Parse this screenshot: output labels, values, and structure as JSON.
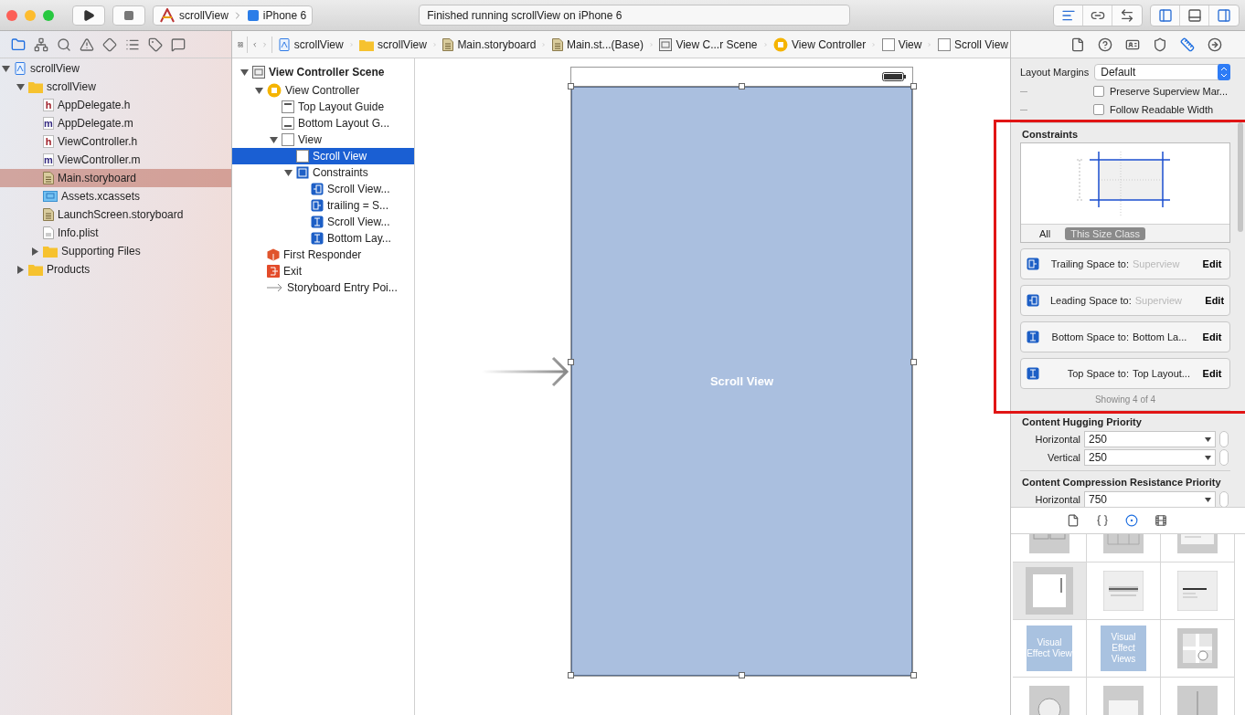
{
  "toolbar": {
    "scheme": "scrollView",
    "device": "iPhone 6",
    "status": "Finished running scrollView on iPhone 6"
  },
  "navigator": {
    "tabs": [
      {
        "kind": "folder",
        "selected": true
      },
      {
        "kind": "hierarchy",
        "selected": false
      },
      {
        "kind": "search",
        "selected": false
      },
      {
        "kind": "warning",
        "selected": false
      },
      {
        "kind": "diamond",
        "selected": false
      },
      {
        "kind": "list",
        "selected": false
      },
      {
        "kind": "tag",
        "selected": false
      },
      {
        "kind": "chat",
        "selected": false
      }
    ],
    "tree": [
      {
        "name": "scrollView",
        "kind": "project",
        "selected": false,
        "expanded": true,
        "children": [
          {
            "name": "scrollView",
            "kind": "folder",
            "selected": false,
            "expanded": true,
            "children": [
              {
                "name": "AppDelegate.h",
                "kind": "file",
                "badge": "h",
                "selected": false
              },
              {
                "name": "AppDelegate.m",
                "kind": "file",
                "badge": "m",
                "selected": false
              },
              {
                "name": "ViewController.h",
                "kind": "file",
                "badge": "h",
                "selected": false
              },
              {
                "name": "ViewController.m",
                "kind": "file",
                "badge": "m",
                "selected": false
              },
              {
                "name": "Main.storyboard",
                "kind": "storyboard",
                "selected": true
              },
              {
                "name": "Assets.xcassets",
                "kind": "assets",
                "selected": false
              },
              {
                "name": "LaunchScreen.storyboard",
                "kind": "storyboard",
                "selected": false
              },
              {
                "name": "Info.plist",
                "kind": "plist",
                "selected": false
              },
              {
                "name": "Supporting Files",
                "kind": "folder",
                "selected": false,
                "expanded": false
              }
            ]
          },
          {
            "name": "Products",
            "kind": "folder",
            "selected": false,
            "expanded": false
          }
        ]
      }
    ]
  },
  "breadcrumb": [
    {
      "label": "scrollView",
      "kind": "project"
    },
    {
      "label": "scrollView",
      "kind": "folder"
    },
    {
      "label": "Main.storyboard",
      "kind": "storyboard"
    },
    {
      "label": "Main.st...(Base)",
      "kind": "storyboard"
    },
    {
      "label": "View C...r Scene",
      "kind": "scene"
    },
    {
      "label": "View Controller",
      "kind": "controller"
    },
    {
      "label": "View",
      "kind": "view"
    },
    {
      "label": "Scroll View",
      "kind": "view"
    }
  ],
  "outline": [
    {
      "name": "View Controller Scene",
      "kind": "scene",
      "selected": false,
      "expanded": true,
      "children": [
        {
          "name": "View Controller",
          "kind": "controller",
          "selected": false,
          "expanded": true,
          "children": [
            {
              "name": "Top Layout Guide",
              "kind": "guide-top",
              "selected": false
            },
            {
              "name": "Bottom Layout G...",
              "kind": "guide-bottom",
              "selected": false
            },
            {
              "name": "View",
              "kind": "view",
              "selected": false,
              "expanded": true,
              "children": [
                {
                  "name": "Scroll View",
                  "kind": "view",
                  "selected": true
                },
                {
                  "name": "Constraints",
                  "kind": "constraints",
                  "selected": false,
                  "expanded": true,
                  "children": [
                    {
                      "name": "Scroll View...",
                      "kind": "constraint-lead",
                      "selected": false
                    },
                    {
                      "name": "trailing = S...",
                      "kind": "constraint-trail",
                      "selected": false
                    },
                    {
                      "name": "Scroll View...",
                      "kind": "constraint-v",
                      "selected": false
                    },
                    {
                      "name": "Bottom Lay...",
                      "kind": "constraint-v",
                      "selected": false
                    }
                  ]
                }
              ]
            }
          ]
        },
        {
          "name": "First Responder",
          "kind": "responder",
          "selected": false
        },
        {
          "name": "Exit",
          "kind": "exit",
          "selected": false
        },
        {
          "name": "Storyboard Entry Poi...",
          "kind": "entry",
          "selected": false
        }
      ]
    }
  ],
  "canvas": {
    "scroll_view_label": "Scroll View"
  },
  "inspector": {
    "tabs": [
      {
        "kind": "file",
        "selected": false
      },
      {
        "kind": "help",
        "selected": false
      },
      {
        "kind": "identity",
        "selected": false
      },
      {
        "kind": "attributes",
        "selected": false
      },
      {
        "kind": "size",
        "selected": true
      },
      {
        "kind": "connections",
        "selected": false
      }
    ],
    "layout_margins": {
      "label": "Layout Margins",
      "value": "Default"
    },
    "options": [
      {
        "label": "Preserve Superview Mar...",
        "checked": false
      },
      {
        "label": "Follow Readable Width",
        "checked": false
      }
    ],
    "constraints": {
      "title": "Constraints",
      "scopes": [
        {
          "label": "All",
          "selected": false
        },
        {
          "label": "This Size Class",
          "selected": true
        }
      ],
      "items": [
        {
          "kind": "trail",
          "label": "Trailing Space to:",
          "target": "Superview",
          "dimmed": true,
          "action": "Edit"
        },
        {
          "kind": "lead",
          "label": "Leading Space to:",
          "target": "Superview",
          "dimmed": true,
          "action": "Edit"
        },
        {
          "kind": "vertical",
          "label": "Bottom Space to:",
          "target": "Bottom La...",
          "dimmed": false,
          "action": "Edit"
        },
        {
          "kind": "vertical",
          "label": "Top Space to:",
          "target": "Top Layout...",
          "dimmed": false,
          "action": "Edit"
        }
      ],
      "footer": "Showing 4 of 4"
    },
    "hugging": {
      "title": "Content Hugging Priority",
      "rows": [
        {
          "label": "Horizontal",
          "value": "250"
        },
        {
          "label": "Vertical",
          "value": "250"
        }
      ]
    },
    "compression": {
      "title": "Content Compression Resistance Priority",
      "rows": [
        {
          "label": "Horizontal",
          "value": "750"
        }
      ]
    }
  },
  "library": {
    "tabs": [
      {
        "kind": "file",
        "selected": false
      },
      {
        "kind": "braces",
        "selected": false
      },
      {
        "kind": "object",
        "selected": true
      },
      {
        "kind": "media",
        "selected": false
      }
    ],
    "tiles": [
      {
        "kind": "collection",
        "selected": false
      },
      {
        "kind": "grid",
        "selected": false
      },
      {
        "kind": "text",
        "selected": false
      },
      {
        "kind": "scroll",
        "selected": true
      },
      {
        "kind": "picker",
        "selected": false
      },
      {
        "kind": "table",
        "selected": false
      },
      {
        "kind": "effect",
        "label": "Visual Effect View",
        "selected": false
      },
      {
        "kind": "effect",
        "label": "Visual Effect Views",
        "selected": false
      },
      {
        "kind": "map",
        "selected": false
      },
      {
        "kind": "round",
        "selected": false
      },
      {
        "kind": "image",
        "selected": false
      },
      {
        "kind": "divider",
        "selected": false
      }
    ]
  }
}
